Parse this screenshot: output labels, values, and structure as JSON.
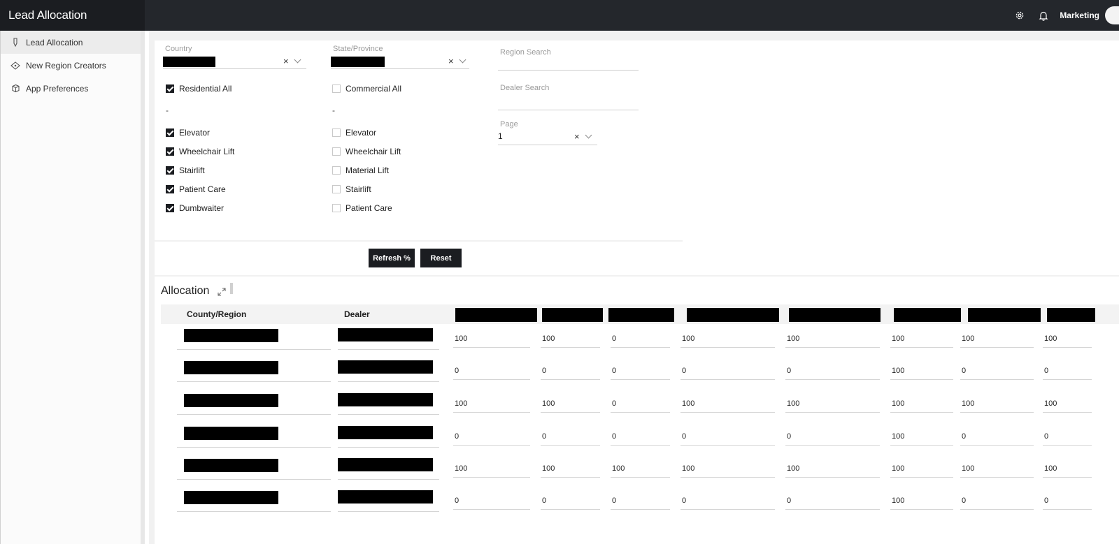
{
  "app": {
    "title": "Lead Allocation",
    "user": "Marketing"
  },
  "topbar_icons": {
    "settings": "gear-icon",
    "notifications": "bell-icon"
  },
  "sidebar": {
    "items": [
      {
        "label": "Lead Allocation",
        "icon": "flag-icon",
        "active": true
      },
      {
        "label": "New Region Creators",
        "icon": "region-icon",
        "active": false
      },
      {
        "label": "App Preferences",
        "icon": "box-icon",
        "active": false
      }
    ]
  },
  "filters": {
    "country": {
      "label": "Country",
      "clear": "×"
    },
    "state": {
      "label": "State/Province",
      "clear": "×"
    },
    "region_search": {
      "label": "Region Search"
    },
    "dealer_search": {
      "label": "Dealer Search"
    },
    "page": {
      "label": "Page",
      "value": "1",
      "clear": "×"
    },
    "residential": {
      "all_label": "Residential All",
      "all_checked": true,
      "separator": "-",
      "items": [
        {
          "label": "Elevator",
          "checked": true
        },
        {
          "label": "Wheelchair Lift",
          "checked": true
        },
        {
          "label": "Stairlift",
          "checked": true
        },
        {
          "label": "Patient Care",
          "checked": true
        },
        {
          "label": "Dumbwaiter",
          "checked": true
        }
      ]
    },
    "commercial": {
      "all_label": "Commercial All",
      "all_checked": false,
      "separator": "-",
      "items": [
        {
          "label": "Elevator",
          "checked": false
        },
        {
          "label": "Wheelchair Lift",
          "checked": false
        },
        {
          "label": "Material Lift",
          "checked": false
        },
        {
          "label": "Stairlift",
          "checked": false
        },
        {
          "label": "Patient Care",
          "checked": false
        }
      ]
    }
  },
  "buttons": {
    "refresh": "Refresh %",
    "reset": "Reset"
  },
  "allocation": {
    "title": "Allocation",
    "headers": {
      "region": "County/Region",
      "dealer": "Dealer"
    },
    "rows": [
      {
        "values": [
          "100",
          "100",
          "0",
          "100",
          "100",
          "100",
          "100",
          "100"
        ]
      },
      {
        "values": [
          "0",
          "0",
          "0",
          "0",
          "0",
          "100",
          "0",
          "0"
        ]
      },
      {
        "values": [
          "100",
          "100",
          "0",
          "100",
          "100",
          "100",
          "100",
          "100"
        ]
      },
      {
        "values": [
          "0",
          "0",
          "0",
          "0",
          "0",
          "100",
          "0",
          "0"
        ]
      },
      {
        "values": [
          "100",
          "100",
          "100",
          "100",
          "100",
          "100",
          "100",
          "100"
        ]
      },
      {
        "values": [
          "0",
          "0",
          "0",
          "0",
          "0",
          "100",
          "0",
          "0"
        ]
      }
    ]
  }
}
